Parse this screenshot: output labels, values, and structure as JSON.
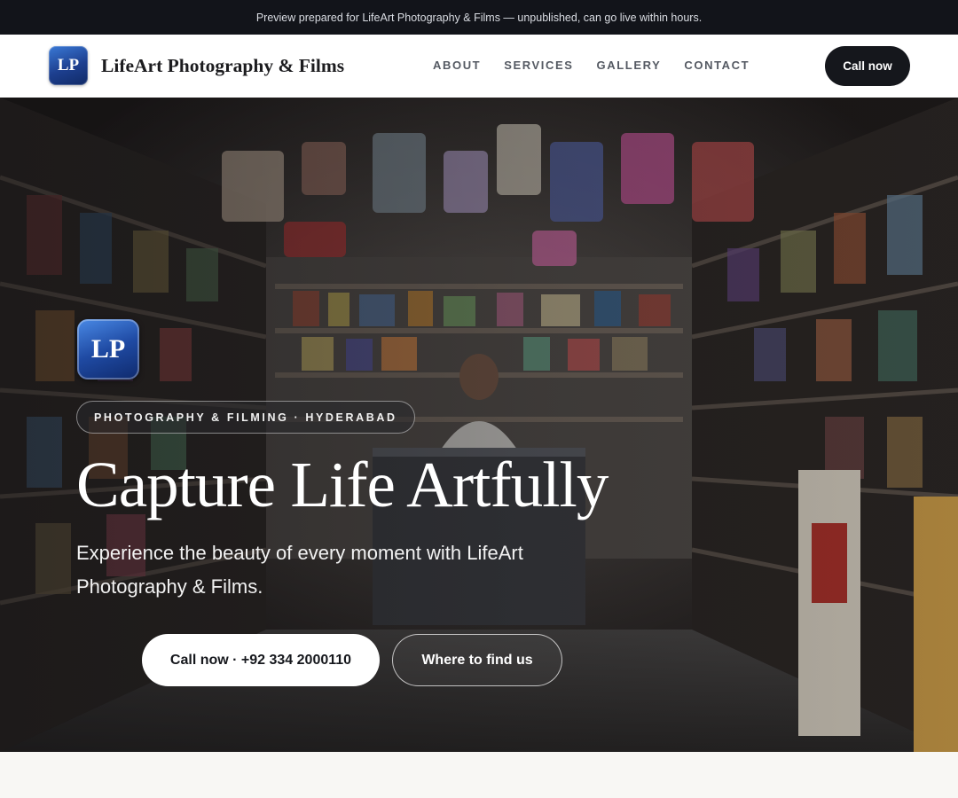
{
  "announcement": "Preview prepared for LifeArt Photography & Films — unpublished, can go live within hours.",
  "brand": {
    "initials": "LP",
    "name": "LifeArt Photography & Films"
  },
  "nav": {
    "items": [
      "ABOUT",
      "SERVICES",
      "GALLERY",
      "CONTACT"
    ],
    "cta": "Call now"
  },
  "hero": {
    "logo_initials": "LP",
    "tagline": "PHOTOGRAPHY & FILMING · HYDERABAD",
    "title": "Capture Life Artfully",
    "subtitle": "Experience the beauty of every moment with LifeArt Photography & Films.",
    "primary_cta": "Call now · +92 334 2000110",
    "secondary_cta": "Where to find us",
    "background_image": "shopkeeper-in-crowded-store-photo"
  },
  "colors": {
    "topbar": "#12141a",
    "brand_blue": "#1f4aa3",
    "dark_button": "#15171c"
  }
}
